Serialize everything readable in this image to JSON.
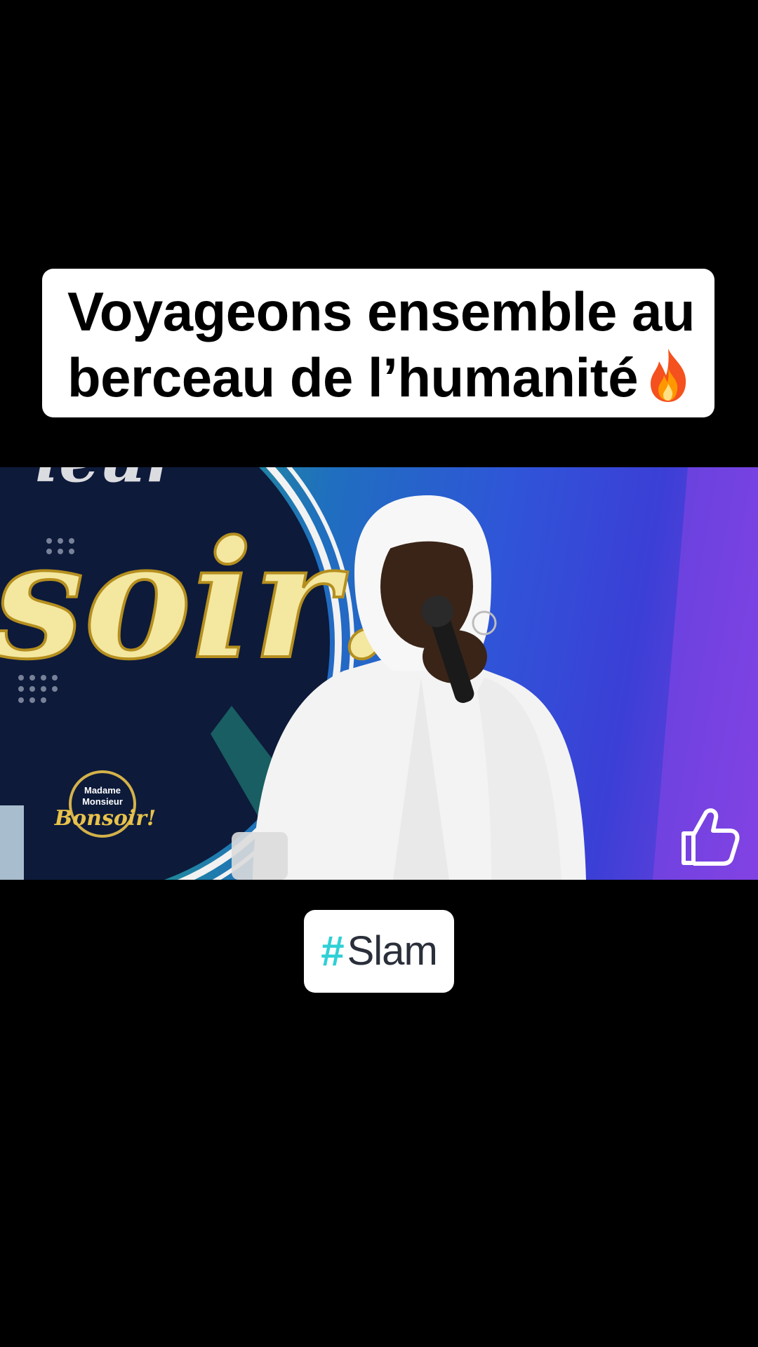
{
  "caption": {
    "line1": "Voyageons ensemble au",
    "line2": "berceau de l’humanité",
    "emoji_icon": "fire-icon"
  },
  "video": {
    "background_text": "soir!",
    "logo_text": {
      "line1": "Madame",
      "line2": "Monsieur",
      "line3": "Bonsoir!"
    },
    "overlay_icon": "thumbs-up-icon"
  },
  "hashtag": {
    "symbol": "#",
    "label": "Slam",
    "symbol_color": "#2fd0d6"
  },
  "colors": {
    "background": "#000000",
    "card": "#ffffff"
  }
}
